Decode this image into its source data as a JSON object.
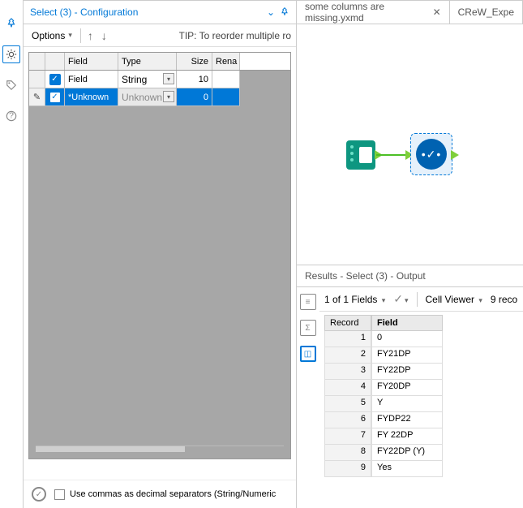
{
  "config": {
    "title": "Select (3) - Configuration",
    "options_label": "Options",
    "tip": "TIP: To reorder multiple ro",
    "columns": {
      "field": "Field",
      "type": "Type",
      "size": "Size",
      "rename": "Rena"
    },
    "rows": [
      {
        "checked": true,
        "field": "Field",
        "type": "String",
        "size": "10",
        "selected": false
      },
      {
        "checked": true,
        "field": "*Unknown",
        "type": "Unknown",
        "size": "0",
        "selected": true
      }
    ],
    "footer_checkbox": "Use commas as decimal separators (String/Numeric"
  },
  "tabs": [
    {
      "label": "some columns are missing.yxmd",
      "closable": true
    },
    {
      "label": "CReW_Expe",
      "closable": false
    }
  ],
  "results": {
    "title": "Results - Select (3) - Output",
    "fields_summary": "1 of 1 Fields",
    "cell_viewer": "Cell Viewer",
    "records_summary": "9 reco",
    "columns": {
      "record": "Record",
      "field": "Field"
    },
    "rows": [
      {
        "n": "1",
        "field": "0"
      },
      {
        "n": "2",
        "field": "FY21DP"
      },
      {
        "n": "3",
        "field": "FY22DP"
      },
      {
        "n": "4",
        "field": "FY20DP"
      },
      {
        "n": "5",
        "field": "Y"
      },
      {
        "n": "6",
        "field": "FYDP22"
      },
      {
        "n": "7",
        "field": "FY 22DP"
      },
      {
        "n": "8",
        "field": "FY22DP (Y)"
      },
      {
        "n": "9",
        "field": "Yes"
      }
    ]
  },
  "chart_data": {
    "type": "table",
    "title": "Results - Select (3) - Output",
    "columns": [
      "Record",
      "Field"
    ],
    "rows": [
      [
        1,
        "0"
      ],
      [
        2,
        "FY21DP"
      ],
      [
        3,
        "FY22DP"
      ],
      [
        4,
        "FY20DP"
      ],
      [
        5,
        "Y"
      ],
      [
        6,
        "FYDP22"
      ],
      [
        7,
        "FY 22DP"
      ],
      [
        8,
        "FY22DP (Y)"
      ],
      [
        9,
        "Yes"
      ]
    ]
  }
}
